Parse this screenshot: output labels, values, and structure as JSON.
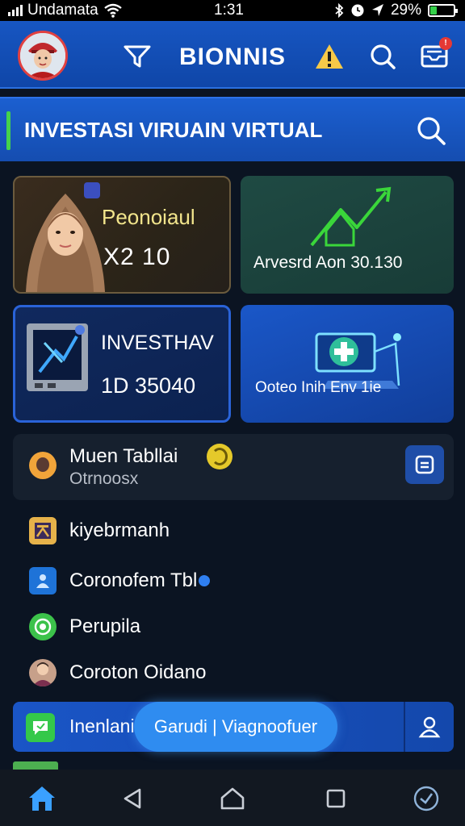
{
  "status_bar": {
    "carrier": "Undamata",
    "time": "1:31",
    "battery_percent": "29%",
    "battery_level": 0.29
  },
  "header": {
    "title": "BIONNIS",
    "icons": [
      "avatar",
      "filter-icon",
      "warning-icon",
      "search-icon",
      "inbox-icon"
    ],
    "notification_badge": "!"
  },
  "search": {
    "title": "INVESTASI VIRUAIN VIRTUAL"
  },
  "cards": {
    "profile": {
      "label": "Peonoiaul",
      "value": "X2 10"
    },
    "return": {
      "label": "Arvesrd Aon 30.130"
    },
    "invest": {
      "label": "INVESTHAV",
      "value": "1D 35040"
    },
    "create": {
      "label": "Ooteo Inih Env 1ie"
    }
  },
  "tablet_row": {
    "title": "Muen Tabllai",
    "subtitle": "Otrnoosx"
  },
  "list": [
    {
      "label": "kiyebrmanh",
      "icon": "grid-icon"
    },
    {
      "label": "Coronofem Tbl",
      "icon": "person-icon"
    },
    {
      "label": "Perupila",
      "icon": "globe-icon"
    },
    {
      "label": "Coroton Oidano",
      "icon": "profile-avatar"
    }
  ],
  "promo": {
    "label": "Inenlani",
    "pill": "Garudi | Viagnoofuer"
  },
  "colors": {
    "header_blue": "#1756c2",
    "background": "#0b1422",
    "accent_green": "#45d24c",
    "gold_text": "#f2e58c"
  }
}
